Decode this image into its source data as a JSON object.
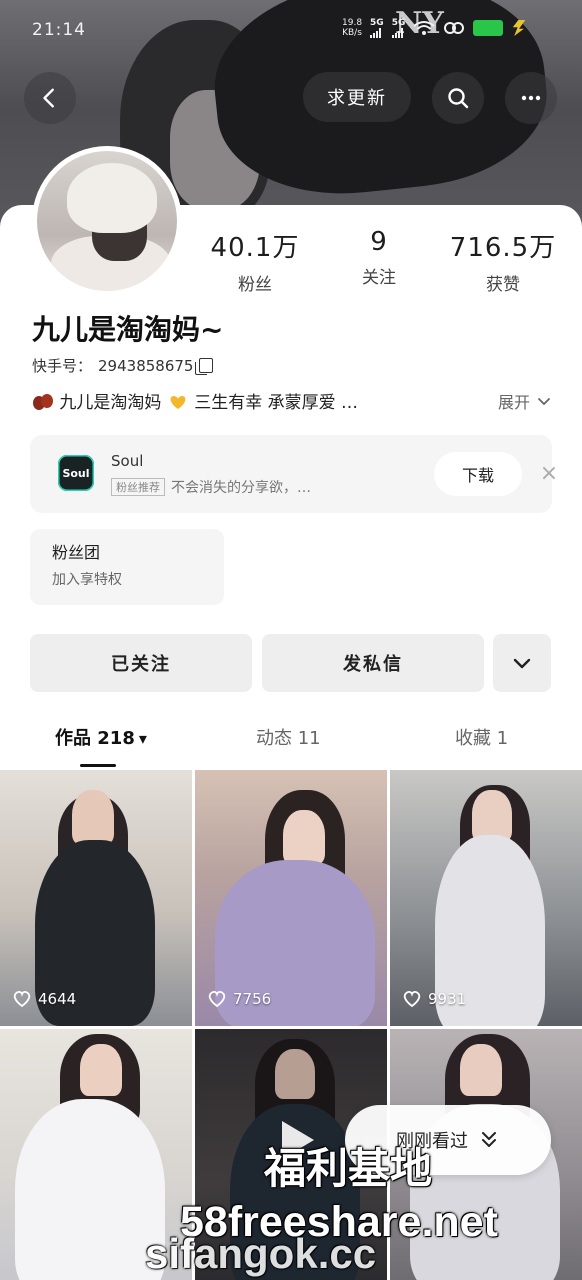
{
  "status_bar": {
    "time": "21:14",
    "speed_value": "19.8",
    "speed_unit": "KB/s",
    "net1": "5G",
    "net2": "5G"
  },
  "header": {
    "update_label": "求更新",
    "logo_text": "NY"
  },
  "profile": {
    "stats": [
      {
        "value": "40.1万",
        "label": "粉丝"
      },
      {
        "value": "9",
        "label": "关注"
      },
      {
        "value": "716.5万",
        "label": "获赞"
      }
    ],
    "nickname": "九儿是淘淘妈~",
    "uid_label": "快手号：",
    "uid": "2943858675",
    "bio": "九儿是淘淘妈",
    "bio_rest": "三生有幸 承蒙厚爱 …",
    "expand_label": "展开"
  },
  "ad": {
    "logo_text": "Soul",
    "title": "Soul",
    "badge": "粉丝推荐",
    "description": "不会消失的分享欲，…",
    "download_label": "下载",
    "close": "×"
  },
  "fan_group": {
    "title": "粉丝团",
    "subtitle": "加入享特权"
  },
  "actions": {
    "followed": "已关注",
    "message": "发私信"
  },
  "tabs": [
    {
      "label": "作品 218"
    },
    {
      "label": "动态 11"
    },
    {
      "label": "收藏 1"
    }
  ],
  "grid": [
    {
      "likes": "4644"
    },
    {
      "likes": "7756"
    },
    {
      "likes": "9931"
    }
  ],
  "just_seen": {
    "label": "刚刚看过"
  },
  "watermark": {
    "cn": "福利基地",
    "url": "58freeshare.net",
    "url2": "sifangok.cc"
  },
  "colors": {
    "accent_green": "#29c64a",
    "soul_teal": "#29d3b6"
  }
}
